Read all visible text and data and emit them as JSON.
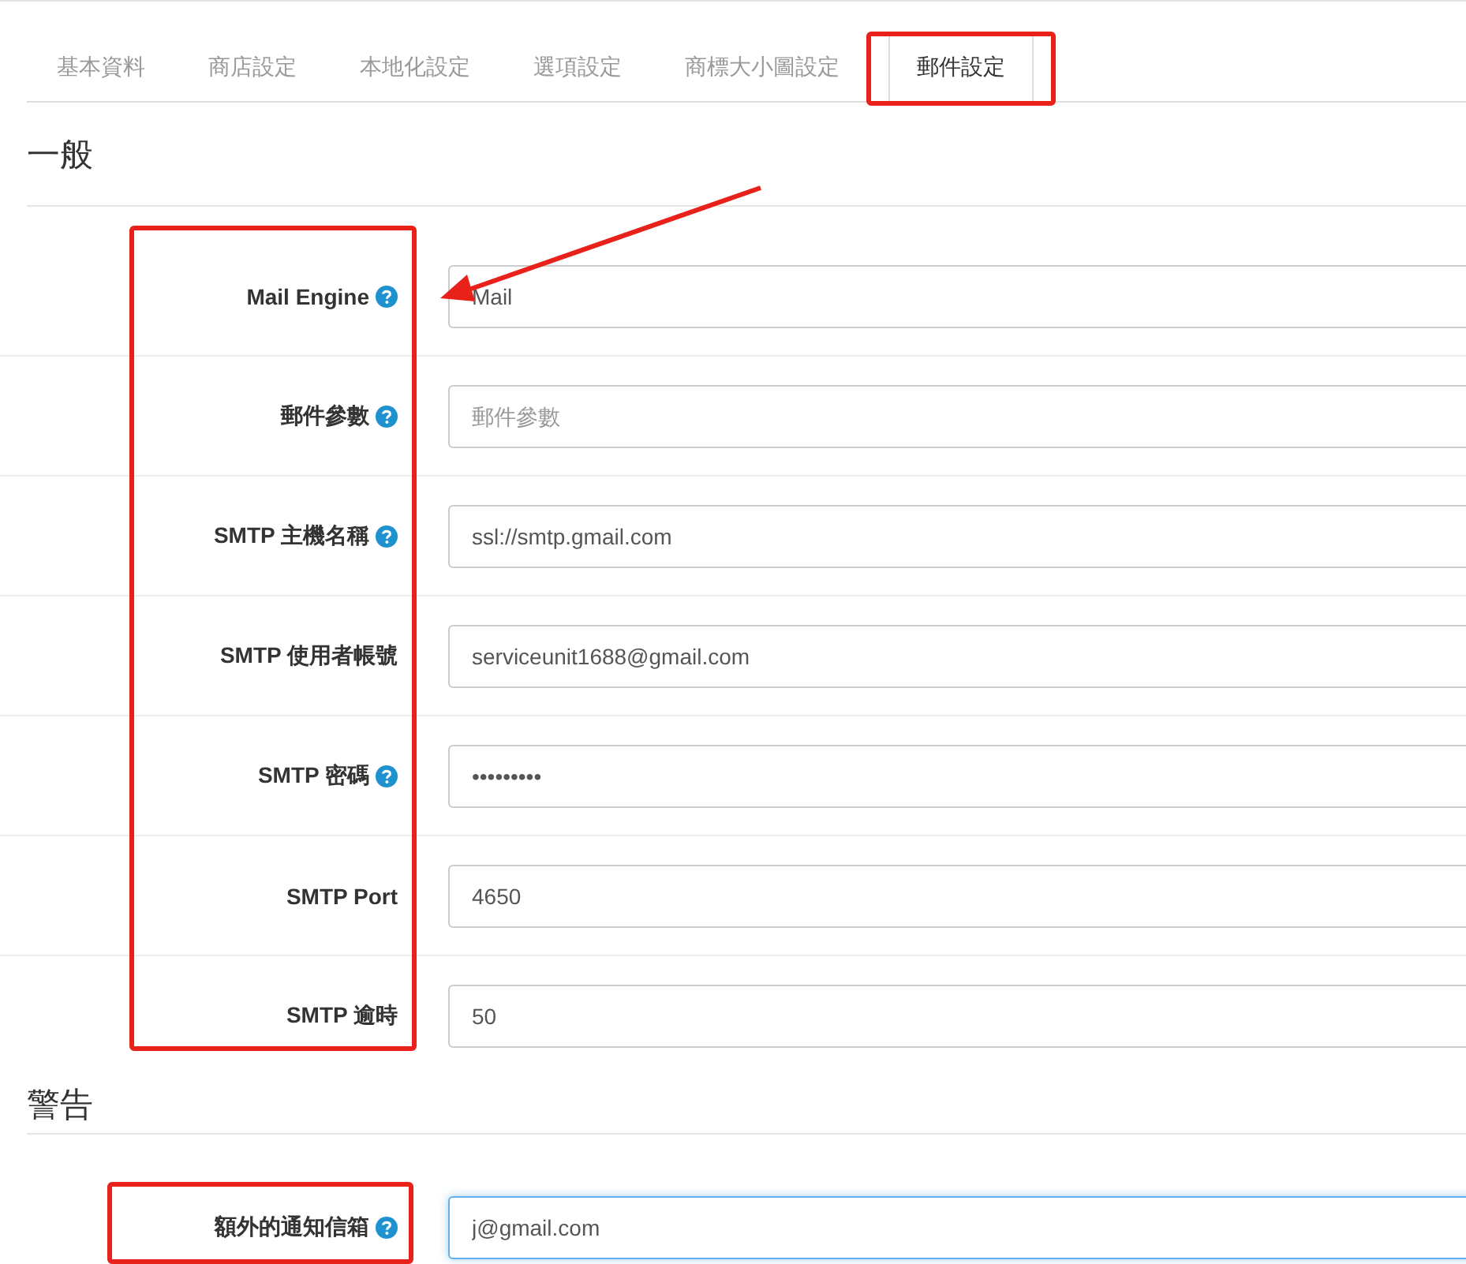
{
  "tabs": [
    {
      "label": "基本資料",
      "selected": false
    },
    {
      "label": "商店設定",
      "selected": false
    },
    {
      "label": "本地化設定",
      "selected": false
    },
    {
      "label": "選項設定",
      "selected": false
    },
    {
      "label": "商標大小圖設定",
      "selected": false
    },
    {
      "label": "郵件設定",
      "selected": true
    }
  ],
  "sections": [
    {
      "heading": "一般",
      "fields": [
        {
          "label": "Mail Engine",
          "help": true,
          "value": "Mail",
          "focused": false
        },
        {
          "label": "郵件參數",
          "help": true,
          "placeholder": "郵件參數",
          "focused": false
        },
        {
          "label": "SMTP 主機名稱",
          "help": true,
          "value": "ssl://smtp.gmail.com",
          "focused": false
        },
        {
          "label": "SMTP 使用者帳號",
          "help": false,
          "value": "serviceunit1688@gmail.com",
          "focused": false
        },
        {
          "label": "SMTP 密碼",
          "help": true,
          "value": "•••••••••",
          "focused": false
        },
        {
          "label": "SMTP Port",
          "help": false,
          "value": "4650",
          "focused": false
        },
        {
          "label": "SMTP 逾時",
          "help": false,
          "value": "50",
          "focused": false
        }
      ]
    },
    {
      "heading": "警告",
      "fields": [
        {
          "label": "額外的通知信箱",
          "help": true,
          "value": "j@gmail.com",
          "focused": true
        }
      ]
    }
  ]
}
